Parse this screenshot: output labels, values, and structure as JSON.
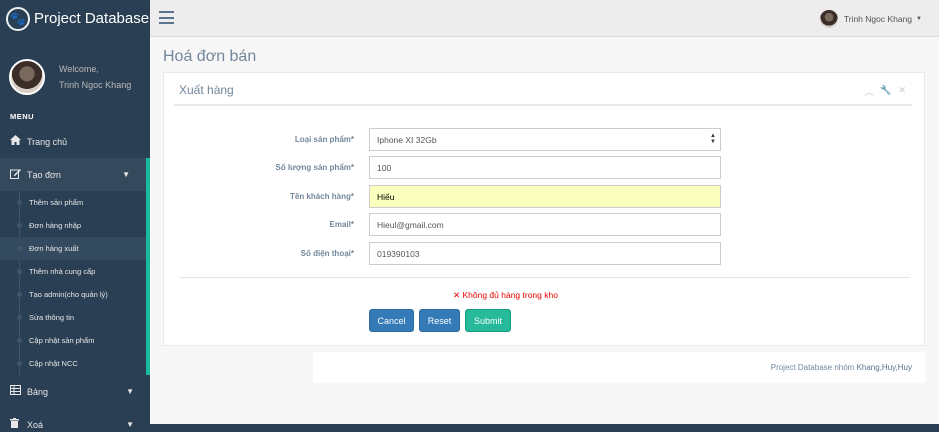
{
  "brand": {
    "title": "Project Database",
    "logo_icon": "paw-icon"
  },
  "profile": {
    "welcome": "Welcome,",
    "name": "Trinh Ngoc Khang"
  },
  "menu": {
    "heading": "MENU",
    "home": {
      "label": "Trang chủ",
      "icon": "home-icon"
    },
    "create": {
      "label": "Tạo đơn",
      "icon": "edit-icon",
      "children": [
        "Thêm sản phẩm",
        "Đơn hàng nhập",
        "Đơn hàng xuất",
        "Thêm nhà cung cấp",
        "Tạo admin(cho quản lý)",
        "Sửa thông tin",
        "Cập nhật sản phẩm",
        "Cập nhật NCC"
      ]
    },
    "table": {
      "label": "Bảng",
      "icon": "table-icon"
    },
    "delete": {
      "label": "Xoá",
      "icon": "trash-icon"
    }
  },
  "topnav": {
    "user_name": "Trinh Ngoc Khang"
  },
  "page": {
    "title": "Hoá đơn bán"
  },
  "panel": {
    "title": "Xuất hàng"
  },
  "form": {
    "product_type_label": "Loại sản phẩm*",
    "product_type_value": "Iphone XI 32Gb",
    "quantity_label": "Số lượng sản phẩm*",
    "quantity_value": "100",
    "customer_label": "Tên khách hàng*",
    "customer_value": "Hiếu",
    "email_label": "Email*",
    "email_value": "Hieul@gmail.com",
    "phone_label": "Số điện thoại*",
    "phone_value": "019390103",
    "error": "✕ Không đủ hàng trong kho"
  },
  "buttons": {
    "cancel": "Cancel",
    "reset": "Reset",
    "submit": "Submit"
  },
  "footer": {
    "text": "Project Database nhóm ",
    "link": "Khang,Huy,Huy"
  },
  "colors": {
    "sidebar": "#2A3F54",
    "accent": "#1ABB9C",
    "primary": "#337AB7",
    "success": "#26B99A",
    "error": "#EE0000",
    "autofill": "#FAFFBD"
  }
}
